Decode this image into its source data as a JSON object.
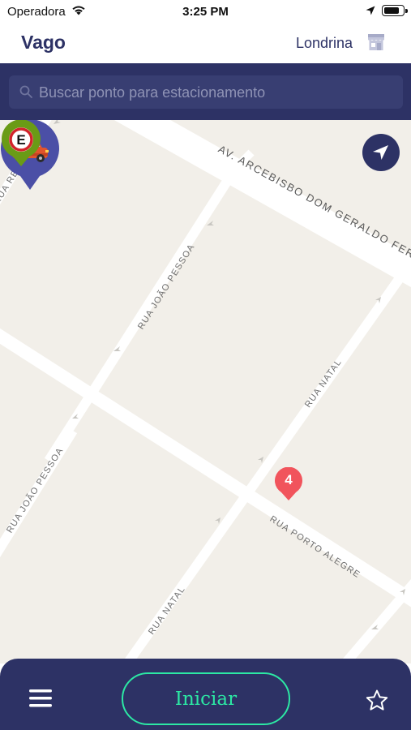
{
  "status_bar": {
    "carrier": "Operadora",
    "time": "3:25 PM",
    "battery_level": 0.85
  },
  "header": {
    "title": "Vago",
    "city": "Londrina",
    "city_icon": "store-icon"
  },
  "search": {
    "placeholder": "Buscar ponto para estacionamento",
    "icon": "search-icon"
  },
  "map": {
    "streets": {
      "arcebisbo": "AV. ARCEBISBO DOM GERALDO FERNANDES",
      "recife": "RUA RECIFE",
      "joao_pessoa_top": "RUA JOÃO PESSOA",
      "joao_pessoa_bottom": "RUA JOÃO PESSOA",
      "natal_top": "RUA NATAL",
      "natal_bottom": "RUA NATAL",
      "porto_alegre": "RUA PORTO ALEGRE"
    },
    "markers": {
      "cluster_count": "4",
      "parking_letter": "E"
    },
    "colors": {
      "car_marker": "#4b4fa6",
      "cluster_marker": "#f1545c",
      "parking_marker": "#6a9b16",
      "parking_ring": "#d2232a"
    }
  },
  "bottom_bar": {
    "start_label": "Iniciar",
    "menu_icon": "menu-icon",
    "favorites_icon": "star-icon"
  },
  "theme": {
    "primary": "#2d3265",
    "accent": "#2ce8a4",
    "map_background": "#f2efe9"
  }
}
